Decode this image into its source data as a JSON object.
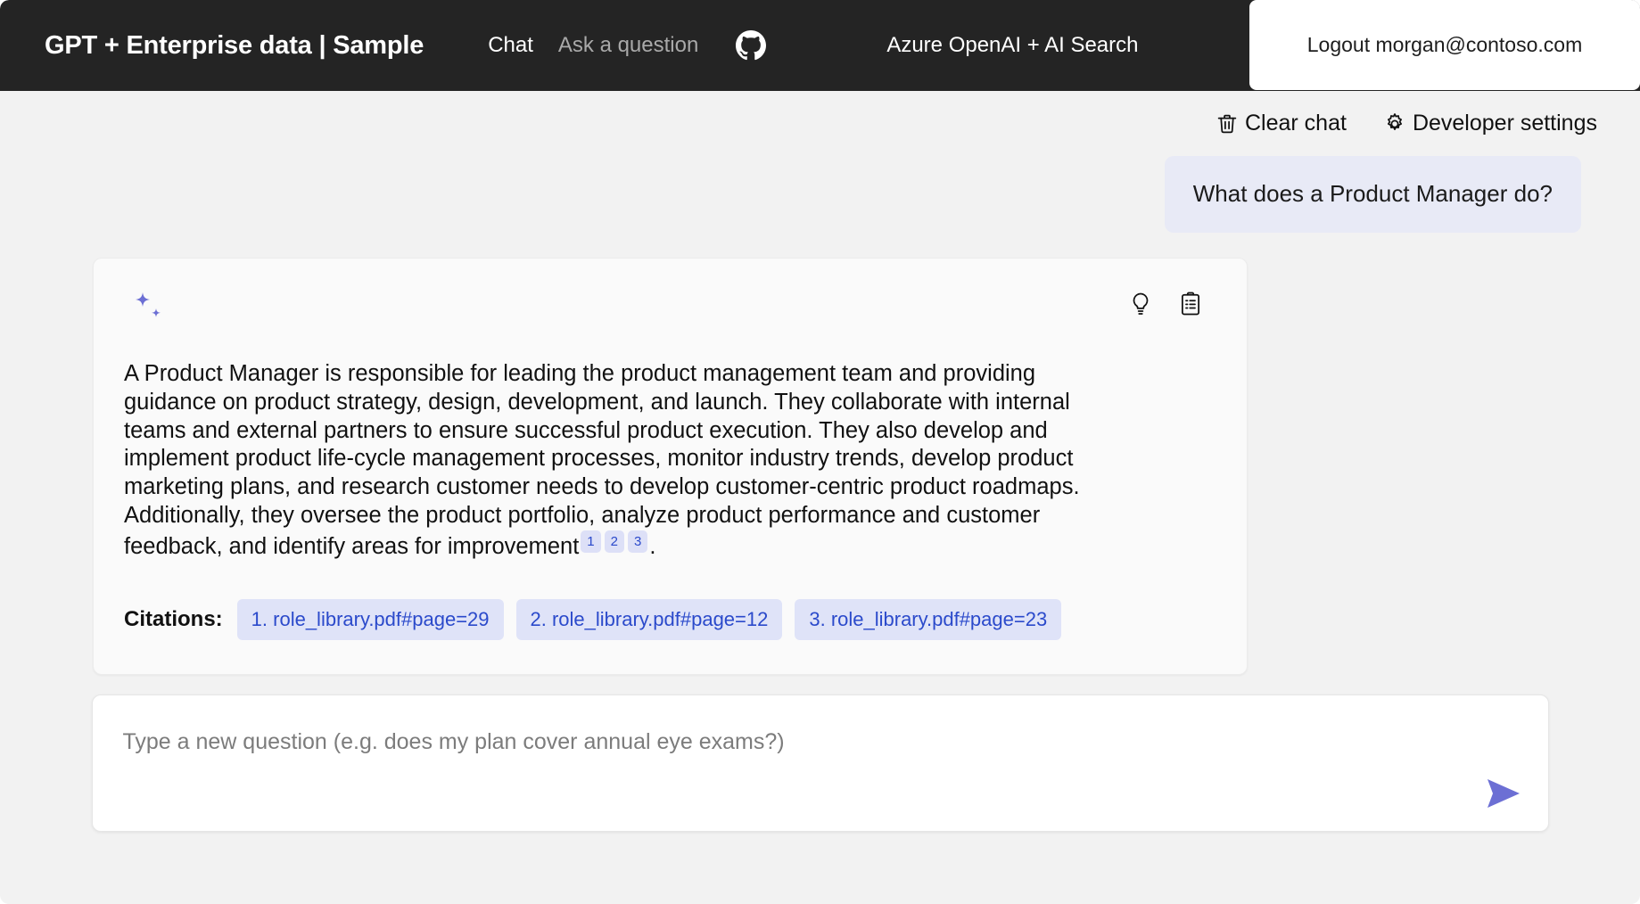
{
  "header": {
    "title": "GPT + Enterprise data | Sample",
    "nav": [
      {
        "label": "Chat",
        "active": true
      },
      {
        "label": "Ask a question",
        "active": false
      }
    ],
    "github_icon": "github-icon",
    "product_label": "Azure OpenAI + AI Search",
    "logout_label": "Logout morgan@contoso.com"
  },
  "command_bar": {
    "clear_chat_label": "Clear chat",
    "clear_chat_icon": "trash-icon",
    "developer_settings_label": "Developer settings",
    "developer_settings_icon": "gear-icon"
  },
  "chat": {
    "user_message": "What does a Product Manager do?",
    "answer": {
      "avatar_icon": "sparkle-icon",
      "actions": [
        {
          "name": "show-thought-process",
          "icon": "lightbulb-icon"
        },
        {
          "name": "show-supporting-content",
          "icon": "clipboard-icon"
        }
      ],
      "text_part_1": "A Product Manager is responsible for leading the product management team and providing guidance on product strategy, design, development, and launch. They collaborate with internal teams and external partners to ensure successful product execution. They also develop and implement product life-cycle management processes, monitor industry trends, develop product marketing plans, and research customer needs to develop customer-centric product roadmaps. Additionally, they oversee the product portfolio, analyze product performance and customer feedback, and identify areas for improvement",
      "sup_1": "1",
      "sup_2": "2",
      "sup_3": "3",
      "text_part_2": ".",
      "citations_label": "Citations:",
      "citations": [
        "1. role_library.pdf#page=29",
        "2. role_library.pdf#page=12",
        "3. role_library.pdf#page=23"
      ]
    }
  },
  "question_input": {
    "placeholder": "Type a new question (e.g. does my plan cover annual eye exams?)",
    "value": "",
    "send_icon": "send-icon"
  },
  "colors": {
    "header_bg": "#242424",
    "page_bg": "#f2f2f2",
    "accent_purple": "#6c6fd4",
    "citation_bg": "#dfe3f8",
    "citation_text": "#2b4acb",
    "user_bubble_bg": "#e8eaf6"
  }
}
